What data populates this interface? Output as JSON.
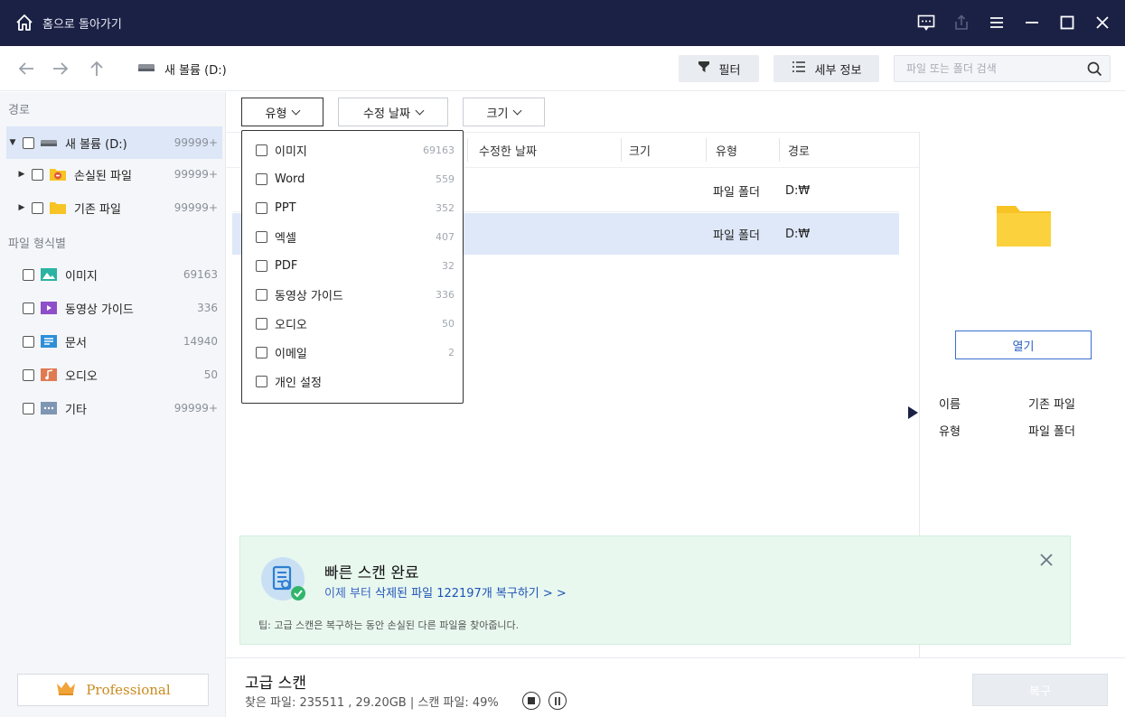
{
  "titlebar": {
    "home_label": "홈으로 돌아가기"
  },
  "nav": {
    "drive_label": "새 볼륨 (D:)",
    "filter_label": "필터",
    "details_label": "세부 정보",
    "search_placeholder": "파일 또는 폴더 검색"
  },
  "sidebar": {
    "path_title": "경로",
    "tree": [
      {
        "label": "새 볼륨 (D:)",
        "count": "99999+"
      },
      {
        "label": "손실된 파일",
        "count": "99999+"
      },
      {
        "label": "기존 파일",
        "count": "99999+"
      }
    ],
    "types_title": "파일 형식별",
    "types": [
      {
        "label": "이미지",
        "count": "69163"
      },
      {
        "label": "동영상 가이드",
        "count": "336"
      },
      {
        "label": "문서",
        "count": "14940"
      },
      {
        "label": "오디오",
        "count": "50"
      },
      {
        "label": "기타",
        "count": "99999+"
      }
    ],
    "pro_label": "Professional"
  },
  "filters": {
    "type": "유형",
    "modified": "수정 날짜",
    "size": "크기"
  },
  "dropdown": [
    {
      "label": "이미지",
      "count": "69163"
    },
    {
      "label": "Word",
      "count": "559"
    },
    {
      "label": "PPT",
      "count": "352"
    },
    {
      "label": "엑셀",
      "count": "407"
    },
    {
      "label": "PDF",
      "count": "32"
    },
    {
      "label": "동영상 가이드",
      "count": "336"
    },
    {
      "label": "오디오",
      "count": "50"
    },
    {
      "label": "이메일",
      "count": "2"
    },
    {
      "label": "개인 설정",
      "count": ""
    }
  ],
  "table": {
    "columns": {
      "modified": "수정한 날짜",
      "size": "크기",
      "type": "유형",
      "path": "경로"
    },
    "rows": [
      {
        "type": "파일 폴더",
        "path": "D:₩"
      },
      {
        "type": "파일 폴더",
        "path": "D:₩"
      }
    ]
  },
  "details": {
    "open_label": "열기",
    "name_key": "이름",
    "name_value": "기존 파일",
    "type_key": "유형",
    "type_value": "파일 폴더"
  },
  "banner": {
    "title": "빠른 스캔 완료",
    "sub_prefix": "이제 부터",
    "sub_link": "삭제된 파일 122197개 복구하기 > >",
    "tip": "팁: 고급 스캔은 복구하는 동안 손실된 다른 파일을 찾아줍니다."
  },
  "bottom": {
    "title": "고급 스캔",
    "status": "찾은 파일: 235511 , 29.20GB | 스캔 파일: 49%",
    "recover_label": "복구"
  },
  "colors": {
    "titlebar": "#1b2145",
    "accent": "#3a6fd0",
    "banner": "#e8f8ef",
    "folder": "#f7c325"
  }
}
